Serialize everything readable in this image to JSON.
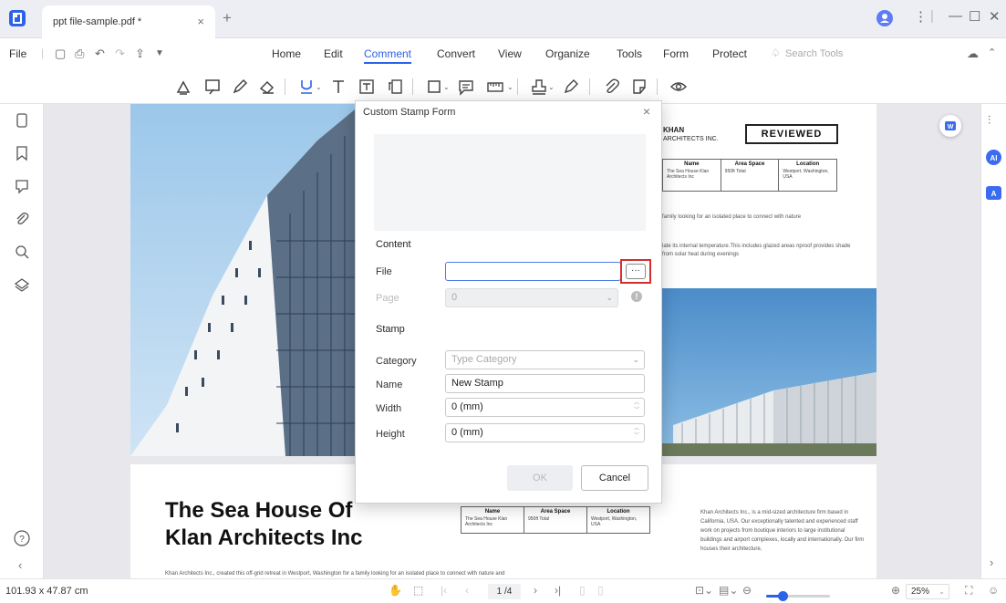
{
  "app": {
    "tab_title": "ppt file-sample.pdf *",
    "tab_close": "×",
    "tab_add": "+"
  },
  "menu": {
    "file": "File",
    "items": [
      "Home",
      "Edit",
      "Comment",
      "Convert",
      "View",
      "Organize",
      "Tools",
      "Form",
      "Protect"
    ],
    "active": "Comment",
    "search_placeholder": "Search Tools"
  },
  "document": {
    "brand_name": "KHAN",
    "brand_sub": "ARCHITECTS INC.",
    "stamp_text": "REVIEWED",
    "table_headers": [
      "Name",
      "Area Space",
      "Location"
    ],
    "table_values": [
      "The Sea House Klan Architects Inc",
      "950ft Total",
      "Westport, Washington, USA"
    ],
    "paragraph_1": "family looking for an isolated place to connect with nature",
    "paragraph_2": "late its internal temperature.This includes glazed areas nproof provides shade from solar heat during evenings",
    "title_line_1": "The Sea House Of",
    "title_line_2": "Klan Architects Inc",
    "footer_text": "Khan Architects Inc., created this off-grid retreat in Westport, Washington for a family looking for an isolated place to connect with nature and",
    "side_text": "Khan Architects Inc., is a mid-sized architecture firm based in California, USA. Our exceptionally talented and experienced staff work on projects from boutique interiors to large institutional buildings and airport complexes, locally and internationally. Our firm houses their architecture,"
  },
  "dialog": {
    "title": "Custom Stamp Form",
    "close": "×",
    "section_content": "Content",
    "file_label": "File",
    "file_value": "",
    "browse": "···",
    "page_label": "Page",
    "page_value": "0",
    "info": "!",
    "section_stamp": "Stamp",
    "category_label": "Category",
    "category_placeholder": "Type Category",
    "name_label": "Name",
    "name_value": "New Stamp",
    "width_label": "Width",
    "width_value": "0 (mm)",
    "height_label": "Height",
    "height_value": "0 (mm)",
    "ok": "OK",
    "cancel": "Cancel"
  },
  "status": {
    "dimensions": "101.93 x 47.87 cm",
    "page": "1 /4",
    "zoom": "25%",
    "zoom_level": 0.25
  },
  "colors": {
    "accent": "#2c62e8",
    "highlight_box": "#d32f2f"
  }
}
